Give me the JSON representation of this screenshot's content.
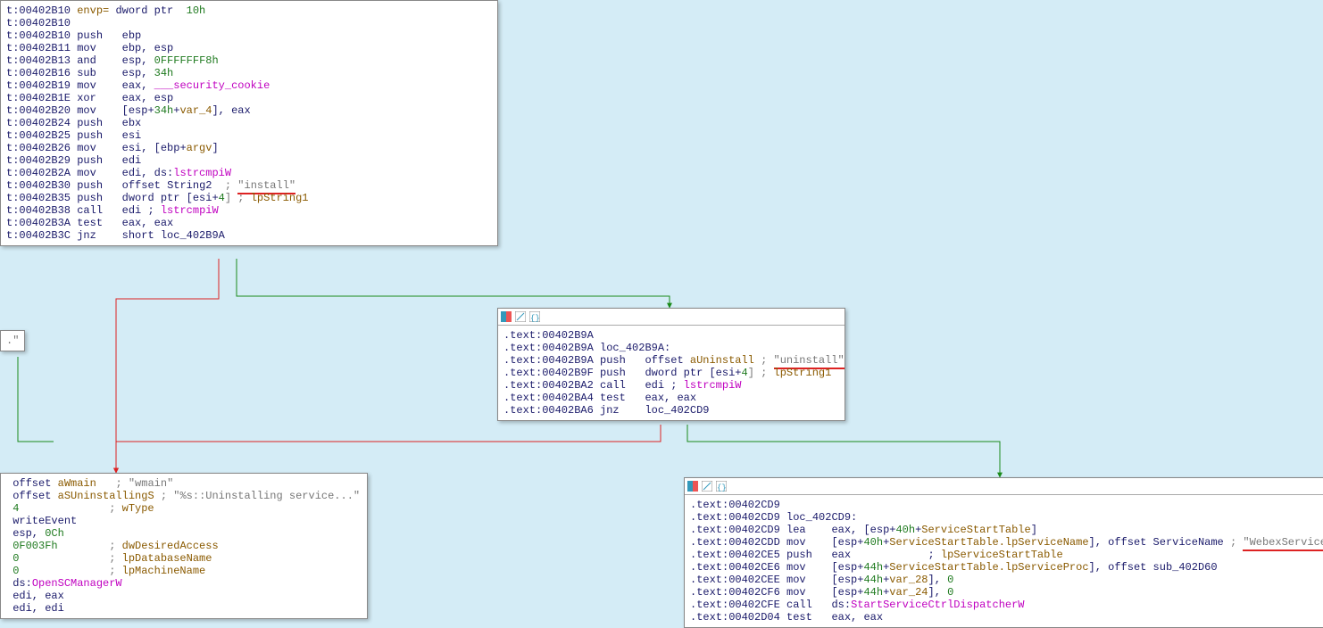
{
  "block1": {
    "lines": [
      {
        "pre": "t:00402B10 ",
        "rest": [
          {
            "t": "envp= ",
            "cls": "c-arg"
          },
          {
            "t": "dword ptr  ",
            "cls": ""
          },
          {
            "t": "10h",
            "cls": "c-num"
          }
        ]
      },
      {
        "pre": "t:00402B10",
        "rest": []
      },
      {
        "pre": "t:00402B10 ",
        "rest": [
          {
            "t": "push   ",
            "cls": ""
          },
          {
            "t": "ebp",
            "cls": ""
          }
        ]
      },
      {
        "pre": "t:00402B11 ",
        "rest": [
          {
            "t": "mov    ",
            "cls": ""
          },
          {
            "t": "ebp, esp",
            "cls": ""
          }
        ]
      },
      {
        "pre": "t:00402B13 ",
        "rest": [
          {
            "t": "and    ",
            "cls": ""
          },
          {
            "t": "esp, ",
            "cls": ""
          },
          {
            "t": "0FFFFFFF8h",
            "cls": "c-num"
          }
        ]
      },
      {
        "pre": "t:00402B16 ",
        "rest": [
          {
            "t": "sub    ",
            "cls": ""
          },
          {
            "t": "esp, ",
            "cls": ""
          },
          {
            "t": "34h",
            "cls": "c-num"
          }
        ]
      },
      {
        "pre": "t:00402B19 ",
        "rest": [
          {
            "t": "mov    ",
            "cls": ""
          },
          {
            "t": "eax, ",
            "cls": ""
          },
          {
            "t": "___security_cookie",
            "cls": "c-sym"
          }
        ]
      },
      {
        "pre": "t:00402B1E ",
        "rest": [
          {
            "t": "xor    ",
            "cls": ""
          },
          {
            "t": "eax, esp",
            "cls": ""
          }
        ]
      },
      {
        "pre": "t:00402B20 ",
        "rest": [
          {
            "t": "mov    ",
            "cls": ""
          },
          {
            "t": "[esp+",
            "cls": ""
          },
          {
            "t": "34h",
            "cls": "c-num"
          },
          {
            "t": "+",
            "cls": ""
          },
          {
            "t": "var_4",
            "cls": "c-var"
          },
          {
            "t": "], eax",
            "cls": ""
          }
        ]
      },
      {
        "pre": "t:00402B24 ",
        "rest": [
          {
            "t": "push   ",
            "cls": ""
          },
          {
            "t": "ebx",
            "cls": ""
          }
        ]
      },
      {
        "pre": "t:00402B25 ",
        "rest": [
          {
            "t": "push   ",
            "cls": ""
          },
          {
            "t": "esi",
            "cls": ""
          }
        ]
      },
      {
        "pre": "t:00402B26 ",
        "rest": [
          {
            "t": "mov    ",
            "cls": ""
          },
          {
            "t": "esi, [ebp+",
            "cls": ""
          },
          {
            "t": "argv",
            "cls": "c-arg"
          },
          {
            "t": "]",
            "cls": ""
          }
        ]
      },
      {
        "pre": "t:00402B29 ",
        "rest": [
          {
            "t": "push   ",
            "cls": ""
          },
          {
            "t": "edi",
            "cls": ""
          }
        ]
      },
      {
        "pre": "t:00402B2A ",
        "rest": [
          {
            "t": "mov    ",
            "cls": ""
          },
          {
            "t": "edi, ds:",
            "cls": ""
          },
          {
            "t": "lstrcmpiW",
            "cls": "c-sym"
          }
        ]
      },
      {
        "pre": "t:00402B30 ",
        "rest": [
          {
            "t": "push   ",
            "cls": ""
          },
          {
            "t": "offset ",
            "cls": ""
          },
          {
            "t": "String2",
            "cls": ""
          },
          {
            "t": "  ; ",
            "cls": "c-cmt"
          },
          {
            "t": "\"install\"",
            "cls": "c-str",
            "ul": true
          }
        ]
      },
      {
        "pre": "t:00402B35 ",
        "rest": [
          {
            "t": "push   ",
            "cls": ""
          },
          {
            "t": "dword ptr [esi+",
            "cls": ""
          },
          {
            "t": "4",
            "cls": "c-num"
          },
          {
            "t": "] ; ",
            "cls": "c-cmt"
          },
          {
            "t": "lpString1",
            "cls": "c-var"
          }
        ]
      },
      {
        "pre": "t:00402B38 ",
        "rest": [
          {
            "t": "call   ",
            "cls": ""
          },
          {
            "t": "edi ; ",
            "cls": ""
          },
          {
            "t": "lstrcmpiW",
            "cls": "c-sym"
          }
        ]
      },
      {
        "pre": "t:00402B3A ",
        "rest": [
          {
            "t": "test   ",
            "cls": ""
          },
          {
            "t": "eax, eax",
            "cls": ""
          }
        ]
      },
      {
        "pre": "t:00402B3C ",
        "rest": [
          {
            "t": "jnz    ",
            "cls": ""
          },
          {
            "t": "short loc_402B9A",
            "cls": ""
          }
        ]
      }
    ]
  },
  "frag": {
    "text": ".\""
  },
  "block2": {
    "lines": [
      {
        "pre": ".text:00402B9A",
        "rest": []
      },
      {
        "pre": ".text:00402B9A ",
        "rest": [
          {
            "t": "loc_402B9A:",
            "cls": ""
          }
        ]
      },
      {
        "pre": ".text:00402B9A ",
        "rest": [
          {
            "t": "push   ",
            "cls": ""
          },
          {
            "t": "offset ",
            "cls": ""
          },
          {
            "t": "aUninstall",
            "cls": "c-ofs"
          },
          {
            "t": " ; ",
            "cls": "c-cmt"
          },
          {
            "t": "\"uninstall\"",
            "cls": "c-str",
            "ul": true
          }
        ]
      },
      {
        "pre": ".text:00402B9F ",
        "rest": [
          {
            "t": "push   ",
            "cls": ""
          },
          {
            "t": "dword ptr [esi+",
            "cls": ""
          },
          {
            "t": "4",
            "cls": "c-num"
          },
          {
            "t": "] ; ",
            "cls": "c-cmt"
          },
          {
            "t": "lpString1",
            "cls": "c-var"
          }
        ]
      },
      {
        "pre": ".text:00402BA2 ",
        "rest": [
          {
            "t": "call   ",
            "cls": ""
          },
          {
            "t": "edi ; ",
            "cls": ""
          },
          {
            "t": "lstrcmpiW",
            "cls": "c-sym"
          }
        ]
      },
      {
        "pre": ".text:00402BA4 ",
        "rest": [
          {
            "t": "test   ",
            "cls": ""
          },
          {
            "t": "eax, eax",
            "cls": ""
          }
        ]
      },
      {
        "pre": ".text:00402BA6 ",
        "rest": [
          {
            "t": "jnz    ",
            "cls": ""
          },
          {
            "t": "loc_402CD9",
            "cls": ""
          }
        ]
      }
    ]
  },
  "block3": {
    "lines": [
      {
        "pre": " ",
        "rest": [
          {
            "t": "offset ",
            "cls": ""
          },
          {
            "t": "aWmain",
            "cls": "c-ofs"
          },
          {
            "t": "   ; ",
            "cls": "c-cmt"
          },
          {
            "t": "\"wmain\"",
            "cls": "c-str"
          }
        ]
      },
      {
        "pre": " ",
        "rest": [
          {
            "t": "offset ",
            "cls": ""
          },
          {
            "t": "aSUninstallingS",
            "cls": "c-ofs"
          },
          {
            "t": " ; ",
            "cls": "c-cmt"
          },
          {
            "t": "\"%s::Uninstalling service...\"",
            "cls": "c-str"
          }
        ]
      },
      {
        "pre": " ",
        "rest": [
          {
            "t": "4",
            "cls": "c-num"
          },
          {
            "t": "              ; ",
            "cls": "c-cmt"
          },
          {
            "t": "wType",
            "cls": "c-var"
          }
        ]
      },
      {
        "pre": " ",
        "rest": [
          {
            "t": "writeEvent",
            "cls": ""
          }
        ]
      },
      {
        "pre": " ",
        "rest": [
          {
            "t": "esp, ",
            "cls": ""
          },
          {
            "t": "0Ch",
            "cls": "c-num"
          }
        ]
      },
      {
        "pre": " ",
        "rest": [
          {
            "t": "0F003Fh",
            "cls": "c-num"
          },
          {
            "t": "        ; ",
            "cls": "c-cmt"
          },
          {
            "t": "dwDesiredAccess",
            "cls": "c-var"
          }
        ]
      },
      {
        "pre": " ",
        "rest": [
          {
            "t": "0",
            "cls": "c-num"
          },
          {
            "t": "              ; ",
            "cls": "c-cmt"
          },
          {
            "t": "lpDatabaseName",
            "cls": "c-var"
          }
        ]
      },
      {
        "pre": " ",
        "rest": [
          {
            "t": "0",
            "cls": "c-num"
          },
          {
            "t": "              ; ",
            "cls": "c-cmt"
          },
          {
            "t": "lpMachineName",
            "cls": "c-var"
          }
        ]
      },
      {
        "pre": " ",
        "rest": [
          {
            "t": "ds:",
            "cls": ""
          },
          {
            "t": "OpenSCManagerW",
            "cls": "c-sym"
          }
        ]
      },
      {
        "pre": " ",
        "rest": [
          {
            "t": "edi, eax",
            "cls": ""
          }
        ]
      },
      {
        "pre": " ",
        "rest": [
          {
            "t": "edi, edi",
            "cls": ""
          }
        ]
      }
    ]
  },
  "block4": {
    "lines": [
      {
        "pre": ".text:00402CD9",
        "rest": []
      },
      {
        "pre": ".text:00402CD9 ",
        "rest": [
          {
            "t": "loc_402CD9:",
            "cls": ""
          }
        ]
      },
      {
        "pre": ".text:00402CD9 ",
        "rest": [
          {
            "t": "lea    ",
            "cls": ""
          },
          {
            "t": "eax, [esp+",
            "cls": ""
          },
          {
            "t": "40h",
            "cls": "c-num"
          },
          {
            "t": "+",
            "cls": ""
          },
          {
            "t": "ServiceStartTable",
            "cls": "c-var"
          },
          {
            "t": "]",
            "cls": ""
          }
        ]
      },
      {
        "pre": ".text:00402CDD ",
        "rest": [
          {
            "t": "mov    ",
            "cls": ""
          },
          {
            "t": "[esp+",
            "cls": ""
          },
          {
            "t": "40h",
            "cls": "c-num"
          },
          {
            "t": "+",
            "cls": ""
          },
          {
            "t": "ServiceStartTable.lpServiceName",
            "cls": "c-var"
          },
          {
            "t": "], offset ",
            "cls": ""
          },
          {
            "t": "ServiceName",
            "cls": ""
          },
          {
            "t": " ; ",
            "cls": "c-cmt"
          },
          {
            "t": "\"WebexService\"",
            "cls": "c-str",
            "ul": true
          }
        ]
      },
      {
        "pre": ".text:00402CE5 ",
        "rest": [
          {
            "t": "push   ",
            "cls": ""
          },
          {
            "t": "eax            ; ",
            "cls": ""
          },
          {
            "t": "lpServiceStartTable",
            "cls": "c-var"
          }
        ]
      },
      {
        "pre": ".text:00402CE6 ",
        "rest": [
          {
            "t": "mov    ",
            "cls": ""
          },
          {
            "t": "[esp+",
            "cls": ""
          },
          {
            "t": "44h",
            "cls": "c-num"
          },
          {
            "t": "+",
            "cls": ""
          },
          {
            "t": "ServiceStartTable.lpServiceProc",
            "cls": "c-var"
          },
          {
            "t": "], offset ",
            "cls": ""
          },
          {
            "t": "sub_402D60",
            "cls": ""
          }
        ]
      },
      {
        "pre": ".text:00402CEE ",
        "rest": [
          {
            "t": "mov    ",
            "cls": ""
          },
          {
            "t": "[esp+",
            "cls": ""
          },
          {
            "t": "44h",
            "cls": "c-num"
          },
          {
            "t": "+",
            "cls": ""
          },
          {
            "t": "var_28",
            "cls": "c-var"
          },
          {
            "t": "], ",
            "cls": ""
          },
          {
            "t": "0",
            "cls": "c-num"
          }
        ]
      },
      {
        "pre": ".text:00402CF6 ",
        "rest": [
          {
            "t": "mov    ",
            "cls": ""
          },
          {
            "t": "[esp+",
            "cls": ""
          },
          {
            "t": "44h",
            "cls": "c-num"
          },
          {
            "t": "+",
            "cls": ""
          },
          {
            "t": "var_24",
            "cls": "c-var"
          },
          {
            "t": "], ",
            "cls": ""
          },
          {
            "t": "0",
            "cls": "c-num"
          }
        ]
      },
      {
        "pre": ".text:00402CFE ",
        "rest": [
          {
            "t": "call   ",
            "cls": ""
          },
          {
            "t": "ds:",
            "cls": ""
          },
          {
            "t": "StartServiceCtrlDispatcherW",
            "cls": "c-sym"
          }
        ]
      },
      {
        "pre": ".text:00402D04 ",
        "rest": [
          {
            "t": "test   ",
            "cls": ""
          },
          {
            "t": "eax, eax",
            "cls": ""
          }
        ]
      }
    ]
  },
  "icons": {
    "color": "#",
    "edit": "#",
    "code": "#"
  }
}
